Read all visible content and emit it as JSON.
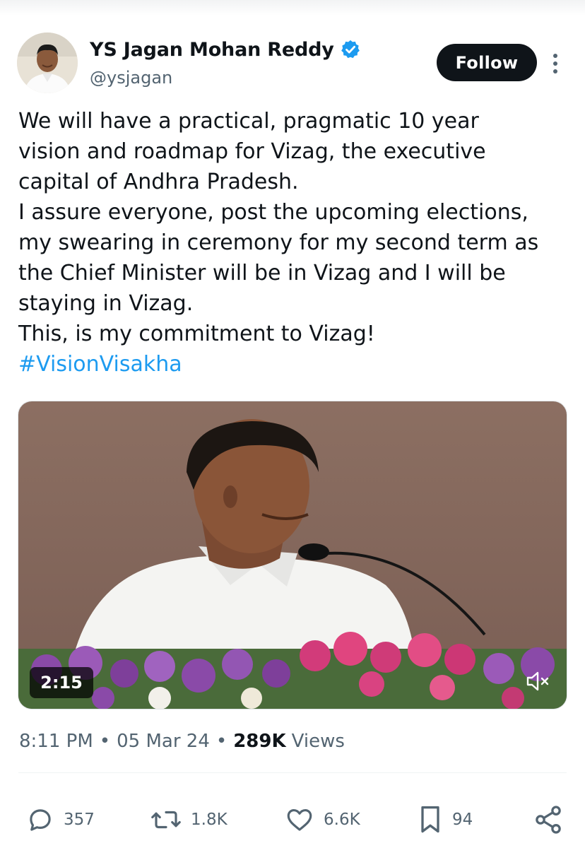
{
  "author": {
    "display_name": "YS Jagan Mohan Reddy",
    "handle": "@ysjagan",
    "verified": true
  },
  "follow_label": "Follow",
  "tweet": {
    "lines": [
      "We will have a practical, pragmatic 10 year",
      "vision and roadmap for Vizag, the executive",
      "capital of Andhra Pradesh.",
      "I assure everyone, post the upcoming elections,",
      "my swearing in ceremony for my second term as",
      "the Chief Minister will be in Vizag and I will be",
      "staying in Vizag.",
      "This, is my commitment to Vizag!"
    ],
    "hashtag": "#VisionVisakha"
  },
  "video": {
    "duration": "2:15"
  },
  "meta": {
    "time": "8:11 PM",
    "separator": "•",
    "date": "05 Mar 24",
    "views_count": "289K",
    "views_label": "Views"
  },
  "actions": {
    "replies": "357",
    "reposts": "1.8K",
    "likes": "6.6K",
    "bookmarks": "94"
  },
  "icons": [
    "verified-badge-icon",
    "more-icon",
    "mute-icon",
    "reply-icon",
    "repost-icon",
    "like-icon",
    "bookmark-icon",
    "share-icon"
  ],
  "colors": {
    "accent": "#1d9bf0",
    "text": "#0f1419",
    "secondary_text": "#536471",
    "follow_button_bg": "#0f1419"
  }
}
